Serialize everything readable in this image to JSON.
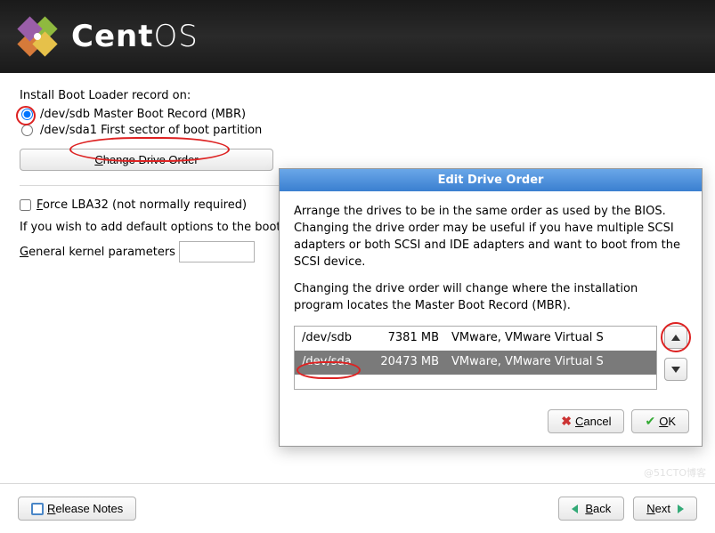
{
  "brand": {
    "prefix": "Cent",
    "suffix": "OS"
  },
  "main": {
    "install_label": "Install Boot Loader record on:",
    "radio1": "/dev/sdb Master Boot Record (MBR)",
    "radio2": "/dev/sda1 First sector of boot partition",
    "change_drive": "Change Drive Order",
    "force_lba": "Force LBA32 (not normally required)",
    "default_opts": "If you wish to add default options to the boot command, enter them into the 'General kernel parameters' field.",
    "gkp_label": "General kernel parameters",
    "gkp_value": ""
  },
  "dialog": {
    "title": "Edit Drive Order",
    "para1": "Arrange the drives to be in the same order as used by the BIOS. Changing the drive order may be useful if you have multiple SCSI adapters or both SCSI and IDE adapters and want to boot from the SCSI device.",
    "para2": "Changing the drive order will change where the installation program locates the Master Boot Record (MBR).",
    "drives": [
      {
        "dev": "/dev/sdb",
        "size": "7381 MB",
        "desc": "VMware, VMware Virtual S",
        "selected": false
      },
      {
        "dev": "/dev/sda",
        "size": "20473 MB",
        "desc": "VMware, VMware Virtual S",
        "selected": true
      }
    ],
    "cancel": "Cancel",
    "ok": "OK"
  },
  "footer": {
    "release_notes": "Release Notes",
    "back": "Back",
    "next": "Next"
  },
  "watermark": "@51CTO博客"
}
